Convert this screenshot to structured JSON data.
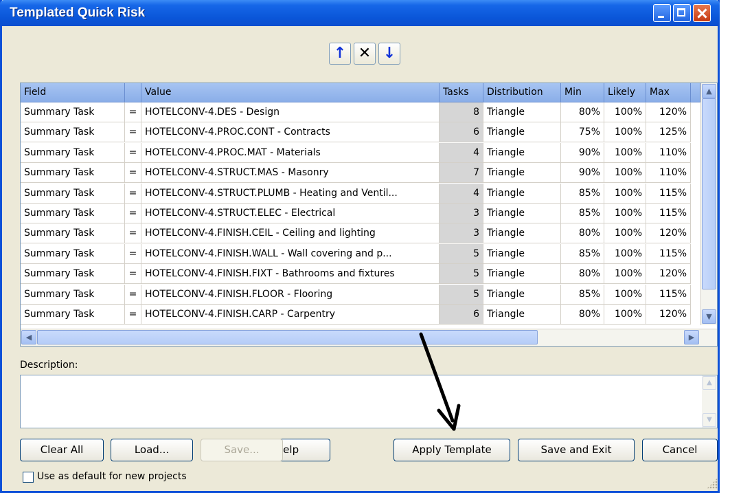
{
  "window": {
    "title": "Templated Quick Risk"
  },
  "toolbar": {
    "up_icon": "↑",
    "delete_icon": "✕",
    "down_icon": "↓"
  },
  "grid": {
    "columns": {
      "field": "Field",
      "operator": "",
      "value": "Value",
      "tasks": "Tasks",
      "distribution": "Distribution",
      "min": "Min",
      "likely": "Likely",
      "max": "Max"
    },
    "rows": [
      {
        "field": "Summary Task",
        "operator": "=",
        "value": "HOTELCONV-4.DES - Design",
        "tasks": "8",
        "distribution": "Triangle",
        "min": "80%",
        "likely": "100%",
        "max": "120%"
      },
      {
        "field": "Summary Task",
        "operator": "=",
        "value": "HOTELCONV-4.PROC.CONT - Contracts",
        "tasks": "6",
        "distribution": "Triangle",
        "min": "75%",
        "likely": "100%",
        "max": "125%"
      },
      {
        "field": "Summary Task",
        "operator": "=",
        "value": "HOTELCONV-4.PROC.MAT - Materials",
        "tasks": "4",
        "distribution": "Triangle",
        "min": "90%",
        "likely": "100%",
        "max": "110%"
      },
      {
        "field": "Summary Task",
        "operator": "=",
        "value": "HOTELCONV-4.STRUCT.MAS - Masonry",
        "tasks": "7",
        "distribution": "Triangle",
        "min": "90%",
        "likely": "100%",
        "max": "110%"
      },
      {
        "field": "Summary Task",
        "operator": "=",
        "value": "HOTELCONV-4.STRUCT.PLUMB - Heating and Ventil...",
        "tasks": "4",
        "distribution": "Triangle",
        "min": "85%",
        "likely": "100%",
        "max": "115%"
      },
      {
        "field": "Summary Task",
        "operator": "=",
        "value": "HOTELCONV-4.STRUCT.ELEC - Electrical",
        "tasks": "3",
        "distribution": "Triangle",
        "min": "85%",
        "likely": "100%",
        "max": "115%"
      },
      {
        "field": "Summary Task",
        "operator": "=",
        "value": "HOTELCONV-4.FINISH.CEIL - Ceiling and lighting",
        "tasks": "3",
        "distribution": "Triangle",
        "min": "80%",
        "likely": "100%",
        "max": "120%"
      },
      {
        "field": "Summary Task",
        "operator": "=",
        "value": "HOTELCONV-4.FINISH.WALL - Wall covering and p...",
        "tasks": "5",
        "distribution": "Triangle",
        "min": "85%",
        "likely": "100%",
        "max": "115%"
      },
      {
        "field": "Summary Task",
        "operator": "=",
        "value": "HOTELCONV-4.FINISH.FIXT - Bathrooms and fixtures",
        "tasks": "5",
        "distribution": "Triangle",
        "min": "80%",
        "likely": "100%",
        "max": "120%"
      },
      {
        "field": "Summary Task",
        "operator": "=",
        "value": "HOTELCONV-4.FINISH.FLOOR - Flooring",
        "tasks": "5",
        "distribution": "Triangle",
        "min": "85%",
        "likely": "100%",
        "max": "115%"
      },
      {
        "field": "Summary Task",
        "operator": "=",
        "value": "HOTELCONV-4.FINISH.CARP - Carpentry",
        "tasks": "6",
        "distribution": "Triangle",
        "min": "80%",
        "likely": "100%",
        "max": "120%"
      }
    ]
  },
  "description": {
    "label": "Description:",
    "value": ""
  },
  "buttons": {
    "clear_all": "Clear All",
    "load": "Load...",
    "save": "Save...",
    "help": "lelp",
    "apply_template": "Apply Template",
    "save_and_exit": "Save and Exit",
    "cancel": "Cancel"
  },
  "default_checkbox": {
    "label": "Use as default for new projects",
    "checked": false
  },
  "colors": {
    "title_bar": "#0a55d8",
    "grid_header": "#8aaee8",
    "tasks_column": "#d6d6d6",
    "dialog_background": "#ece9d8"
  }
}
